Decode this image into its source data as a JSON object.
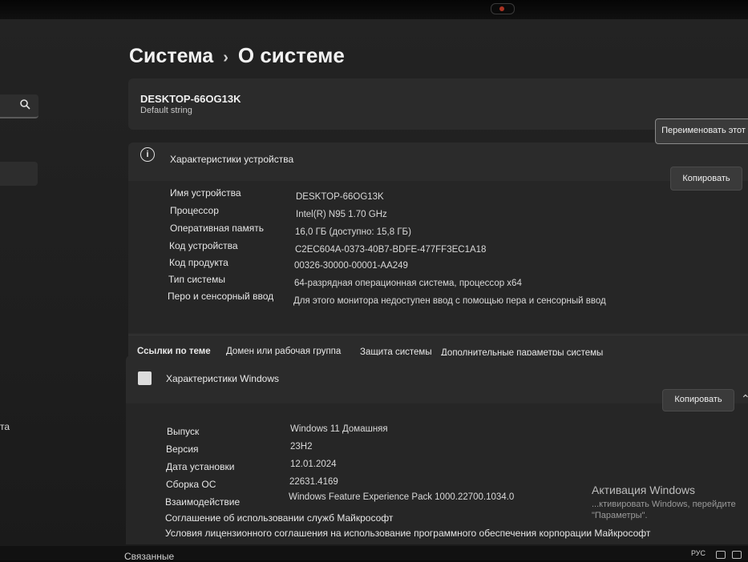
{
  "breadcrumb": {
    "parent": "Система",
    "separator": "›",
    "current": "О системе"
  },
  "device": {
    "name": "DESKTOP-66OG13K",
    "subtitle": "Default string",
    "rename_button": "Переименовать этот П"
  },
  "device_specs": {
    "title": "Характеристики устройства",
    "copy_button": "Копировать",
    "rows": [
      {
        "label": "Имя устройства",
        "value": "DESKTOP-66OG13K"
      },
      {
        "label": "Процессор",
        "value": "Intel(R) N95   1.70 GHz"
      },
      {
        "label": "Оперативная память",
        "value": "16,0 ГБ (доступно: 15,8 ГБ)"
      },
      {
        "label": "Код устройства",
        "value": "C2EC604A-0373-40B7-BDFE-477FF3EC1A18"
      },
      {
        "label": "Код продукта",
        "value": "00326-30000-00001-AA249"
      },
      {
        "label": "Тип системы",
        "value": "64-разрядная операционная система, процессор x64"
      },
      {
        "label": "Перо и сенсорный ввод",
        "value": "Для этого монитора недоступен ввод с помощью пера и сенсорный ввод"
      }
    ]
  },
  "related_links": {
    "title": "Ссылки по теме",
    "items": [
      "Домен или рабочая группа",
      "Защита системы",
      "Дополнительные параметры системы"
    ]
  },
  "windows_specs": {
    "title": "Характеристики Windows",
    "copy_button": "Копировать",
    "rows": [
      {
        "label": "Выпуск",
        "value": "Windows 11 Домашняя"
      },
      {
        "label": "Версия",
        "value": "23H2"
      },
      {
        "label": "Дата установки",
        "value": "12.01.2024"
      },
      {
        "label": "Сборка ОС",
        "value": "22631.4169"
      },
      {
        "label": "Взаимодействие",
        "value": "Windows Feature Experience Pack 1000.22700.1034.0"
      }
    ],
    "links": [
      "Соглашение об использовании служб Майкрософт",
      "Условия лицензионного соглашения на использование программного обеспечения корпорации Майкрософт"
    ]
  },
  "activation": {
    "title": "Активация Windows",
    "line1": "...ктивировать Windows, перейдите",
    "line2": "\"Параметры\"."
  },
  "nav": {
    "fragment": "та"
  },
  "footer": {
    "related": "Связанные",
    "lang": "РУС"
  },
  "icons": {
    "info": "info-icon",
    "windows": "windows-logo-icon",
    "search": "search-icon",
    "chevron": "chevron-up-icon"
  }
}
